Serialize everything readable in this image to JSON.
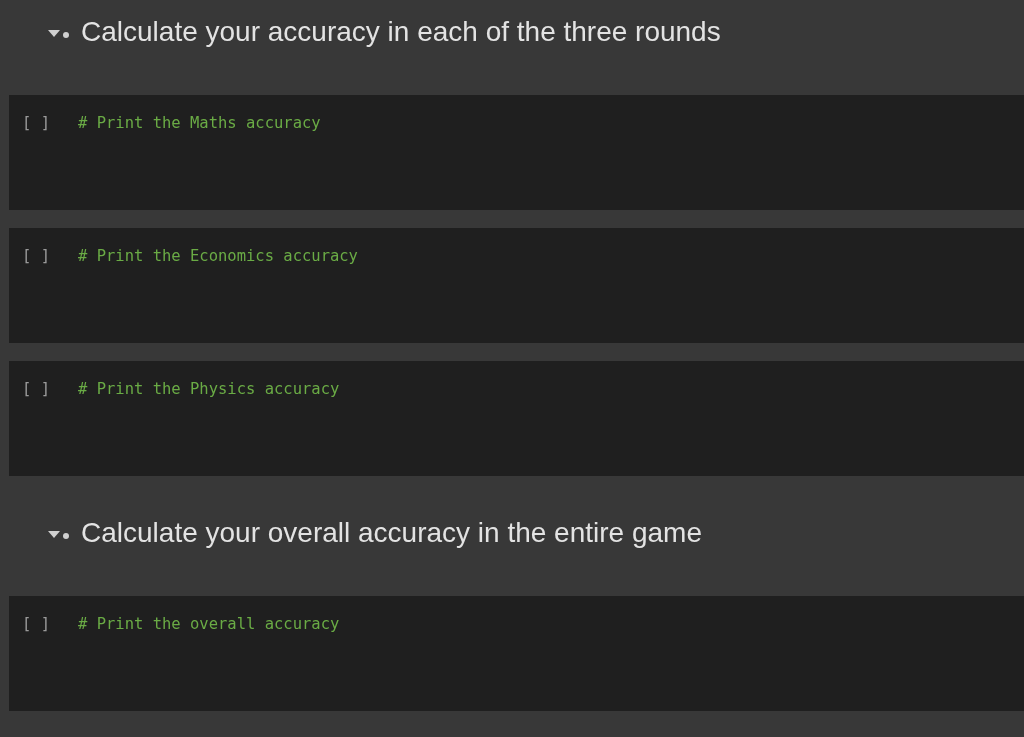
{
  "sections": [
    {
      "heading": "Calculate your accuracy in each of the three rounds",
      "expanded": true,
      "cells": [
        {
          "prompt": "[ ]",
          "code": "# Print the Maths accuracy"
        },
        {
          "prompt": "[ ]",
          "code": "# Print the Economics accuracy"
        },
        {
          "prompt": "[ ]",
          "code": "# Print the Physics accuracy"
        }
      ]
    },
    {
      "heading": "Calculate your overall accuracy in the entire game",
      "expanded": true,
      "cells": [
        {
          "prompt": "[ ]",
          "code": "# Print the overall accuracy"
        }
      ]
    }
  ]
}
